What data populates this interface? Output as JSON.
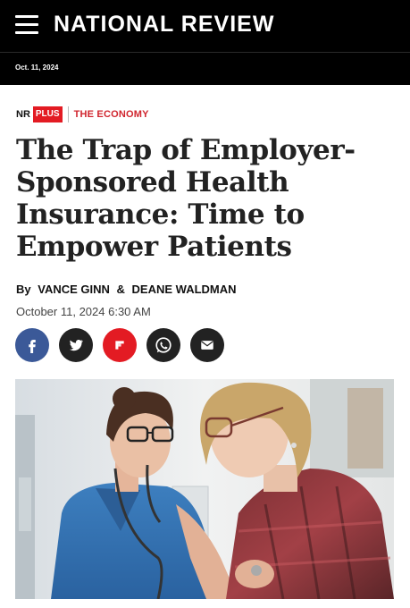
{
  "header": {
    "menu_icon": "hamburger-menu-icon",
    "brand": "NATIONAL REVIEW"
  },
  "datebar": {
    "date": "Oct. 11, 2024"
  },
  "article": {
    "tag_nr": "NR",
    "tag_plus": "PLUS",
    "category": "THE ECONOMY",
    "headline": "The Trap of Employer-Sponsored Health Insurance: Time to Empower Patients",
    "by": "By",
    "authors": [
      "VANCE GINN",
      "DEANE WALDMAN"
    ],
    "amp": "&",
    "dateline": "October 11, 2024 6:30 AM"
  },
  "share": [
    {
      "icon": "facebook-icon",
      "color": "#3b5998"
    },
    {
      "icon": "twitter-icon",
      "color": "#222222"
    },
    {
      "icon": "flipboard-icon",
      "color": "#e31b23"
    },
    {
      "icon": "whatsapp-icon",
      "color": "#222222"
    },
    {
      "icon": "email-icon",
      "color": "#222222"
    }
  ],
  "colors": {
    "accent_red": "#e31b23",
    "header_bg": "#000000"
  }
}
